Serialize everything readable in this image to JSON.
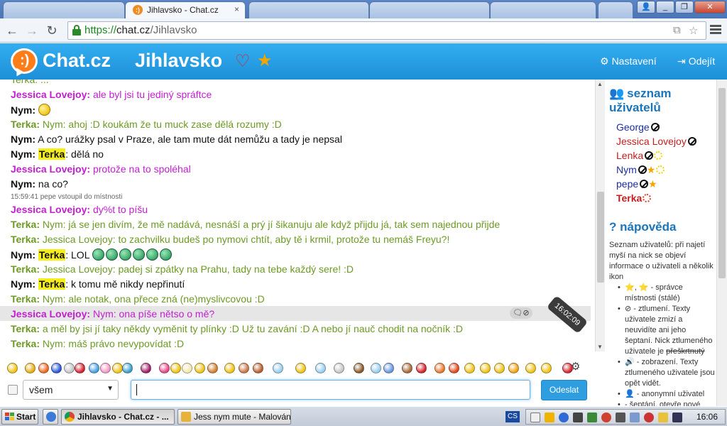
{
  "browser": {
    "tabs": [
      {
        "title": "Jihlavsko - Chat.cz",
        "close": "×"
      }
    ],
    "url": {
      "scheme": "https://",
      "host": "chat.cz",
      "path": "/Jihlavsko"
    },
    "window_buttons": [
      "_",
      "❐",
      "✕"
    ]
  },
  "site": {
    "logo_face": ":)",
    "logo_text": "Chat.cz",
    "room_title": "Jihlavsko",
    "settings_label": "Nastavení",
    "logout_label": "Odejít"
  },
  "chat": {
    "top_partial": "Terka: ...",
    "messages": [
      {
        "nick": "Jessica Lovejoy:",
        "text": "ale byl jsi tu jediný spráftce",
        "style": "jessica"
      },
      {
        "nick": "Nym:",
        "text": "",
        "style": "nym",
        "smileys": 1
      },
      {
        "nick": "Terka:",
        "text": "Nym: ahoj :D koukám že tu muck zase dělá rozumy :D",
        "style": "terka"
      },
      {
        "nick": "Nym:",
        "text": "A co? urážky psal v Praze, ale tam mute dát nemůžu a tady je nepsal",
        "style": "nym"
      },
      {
        "nick": "Nym:",
        "highlight": "Terka",
        "text": ": dělá no",
        "style": "nym"
      },
      {
        "nick": "Jessica Lovejoy:",
        "text": "protože na to spoléhal",
        "style": "jessica"
      },
      {
        "nick": "Nym:",
        "text": "na co?",
        "style": "nym"
      },
      {
        "nick": "Jessica Lovejoy:",
        "text": "dy%t to píšu",
        "style": "jessica"
      },
      {
        "nick": "Terka:",
        "text": "Nym: já se jen divím, že mě nadává, nesnáší a prý jí šikanuju ale když přijdu já, tak sem najednou přijde",
        "style": "terka"
      },
      {
        "nick": "Terka:",
        "text": "Jessica Lovejoy: to zachvilku budeš po nymovi chtít, aby tě i krmil, protože tu nemáš Freyu?!",
        "style": "terka"
      },
      {
        "nick": "Nym:",
        "highlight": "Terka",
        "text": ": LOL",
        "style": "nym",
        "grins": 6
      },
      {
        "nick": "Terka:",
        "text": "Jessica Lovejoy: padej si zpátky na Prahu, tady na tebe každý sere! :D",
        "style": "terka"
      },
      {
        "nick": "Nym:",
        "highlight": "Terka",
        "text": ": k tomu mě nikdy nepřinutí",
        "style": "nym"
      },
      {
        "nick": "Terka:",
        "text": "Nym: ale notak, ona přece zná (ne)myslivcovou :D",
        "style": "terka"
      },
      {
        "nick": "Jessica Lovejoy:",
        "text": "Nym: ona píše nětso o mě?",
        "style": "jessica"
      },
      {
        "nick": "Terka:",
        "text": "a měl by jsi jí taky někdy vyměnit ty plínky :D Už tu zavání :D A nebo jí nauč chodit na nočník :D",
        "style": "terka"
      },
      {
        "nick": "Terka:",
        "text": "Nym: máš právo nevypovídat :D",
        "style": "terka"
      }
    ],
    "system_message": "15:59:41 pepe vstoupil do místnosti",
    "timestamp_tooltip": "16:02:09",
    "msg_actions": "🗨⊘"
  },
  "sidebar": {
    "users_heading": "seznam uživatelů",
    "users": [
      {
        "name": "George",
        "style": "george",
        "ban": true,
        "star": false,
        "sun": ""
      },
      {
        "name": "Jessica Lovejoy",
        "style": "jessica",
        "ban": true,
        "star": false,
        "sun": ""
      },
      {
        "name": "Lenka",
        "style": "lenka",
        "ban": true,
        "star": false,
        "sun": "yellow"
      },
      {
        "name": "Nym",
        "style": "nym",
        "ban": true,
        "star": true,
        "sun": "yellow"
      },
      {
        "name": "pepe",
        "style": "pepe",
        "ban": true,
        "star": true,
        "sun": ""
      },
      {
        "name": "Terka",
        "style": "terka",
        "ban": false,
        "star": false,
        "sun": "red"
      }
    ],
    "help_heading": "nápověda",
    "help_intro": "Seznam uživatelů: při najetí myší na nick se objeví informace o uživateli a několik ikon",
    "help_items": [
      "⭐, ⭐ - správce místnosti (stálé)",
      "⊘ - ztlumení. Texty uživatele zmizí a neuvidíte ani jeho šeptaní. Nick ztlumeného uživatele je",
      "🔊 - zobrazení. Texty ztlumeného uživatele jsou opět vidět.",
      "👤 - anonymní uživatel",
      "- šeptání, otevře nové"
    ],
    "help_strike": "přeškrtnutý"
  },
  "input": {
    "recipient": "všem",
    "send_label": "Odeslat"
  },
  "taskbar": {
    "start_label": "Start",
    "tasks": [
      "Jihlavsko - Chat.cz - ...",
      "Jess nym mute - Malování"
    ],
    "lang": "CS",
    "clock": "16:06"
  }
}
